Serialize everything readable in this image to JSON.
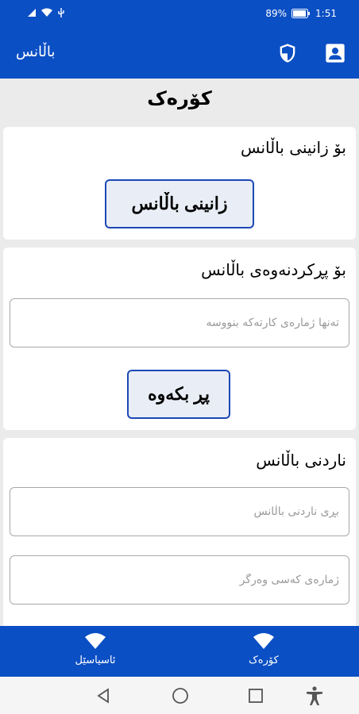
{
  "status_bar": {
    "battery": "89%",
    "time": "1:51"
  },
  "app_bar": {
    "title": "باڵانس"
  },
  "page": {
    "title": "کۆرەک"
  },
  "check_balance": {
    "title": "بۆ زانینی باڵانس",
    "button_label": "زانینی باڵانس"
  },
  "recharge": {
    "title": "بۆ پڕکردنەوەی باڵانس",
    "card_input": {
      "value": "",
      "placeholder": "تەنها ژمارەی کارتەکە بنووسە"
    },
    "button_label": "پڕ بکەوە"
  },
  "send_balance": {
    "title": "ناردنی باڵانس",
    "amount_input": {
      "value": "",
      "placeholder": "بڕی ناردنی باڵانس"
    },
    "recipient_input": {
      "value": "",
      "placeholder": "ژمارەی کەسی وەرگر"
    }
  },
  "bottom_nav": {
    "items": [
      {
        "label": "ئاسیاسێل",
        "icon": "wifi-icon"
      },
      {
        "label": "کۆرەک",
        "icon": "wifi-icon"
      }
    ]
  },
  "colors": {
    "primary": "#0b4fc4",
    "button_border": "#1c48b6",
    "background": "#ebebeb"
  }
}
